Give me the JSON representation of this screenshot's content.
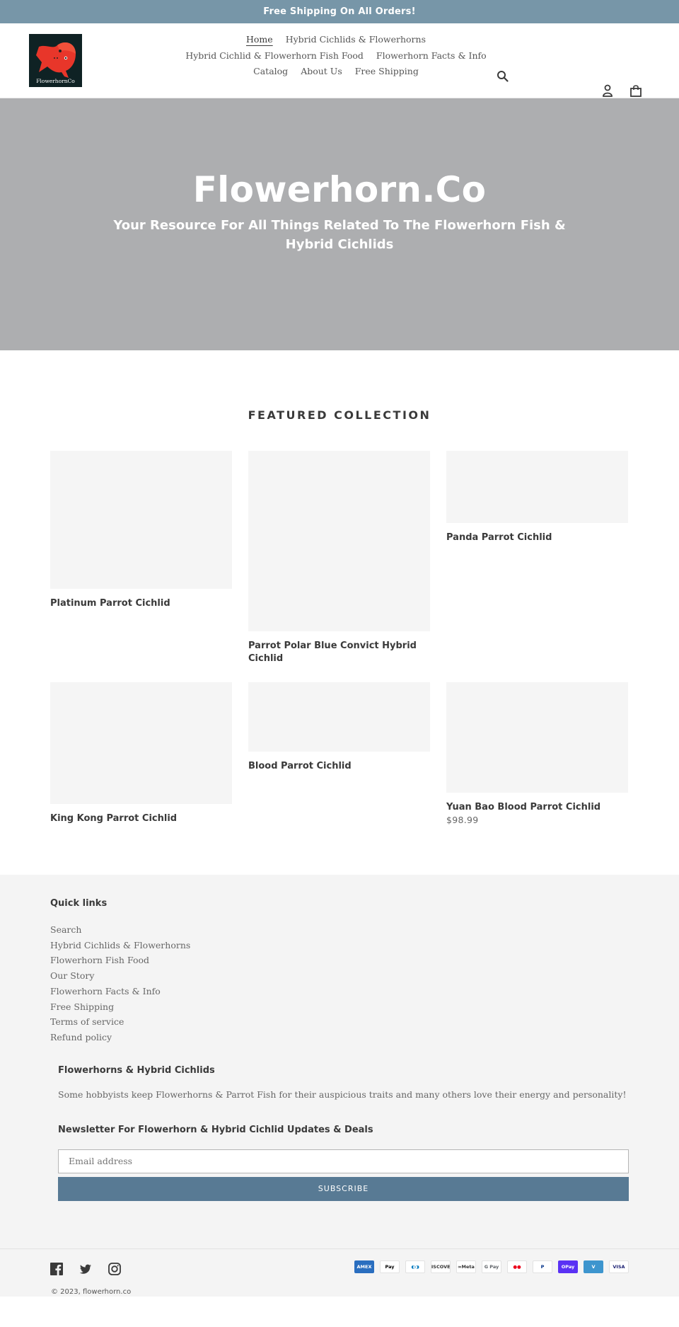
{
  "announcement": "Free Shipping On All Orders!",
  "header": {
    "logo_text": "FlowerhornCo",
    "nav": [
      [
        {
          "label": "Home",
          "active": true
        },
        {
          "label": "Hybrid Cichlids & Flowerhorns"
        }
      ],
      [
        {
          "label": "Hybrid Cichlid & Flowerhorn Fish Food"
        },
        {
          "label": "Flowerhorn Facts & Info"
        }
      ],
      [
        {
          "label": "Catalog"
        },
        {
          "label": "About Us"
        },
        {
          "label": "Free Shipping"
        }
      ]
    ],
    "icons": {
      "search": "search-icon",
      "account": "account-icon",
      "cart": "cart-icon"
    }
  },
  "hero": {
    "title": "Flowerhorn.Co",
    "subtitle": "Your Resource For All Things Related To The Flowerhorn Fish & Hybrid Cichlids"
  },
  "featured": {
    "heading": "FEATURED COLLECTION",
    "products": [
      {
        "title": "Platinum Parrot Cichlid",
        "price": ""
      },
      {
        "title": "Parrot Polar Blue Convict Hybrid Cichlid",
        "price": ""
      },
      {
        "title": "Panda Parrot Cichlid",
        "price": ""
      },
      {
        "title": "King Kong Parrot Cichlid",
        "price": ""
      },
      {
        "title": "Blood Parrot Cichlid",
        "price": ""
      },
      {
        "title": "Yuan Bao Blood Parrot Cichlid",
        "price": "$98.99"
      }
    ]
  },
  "footer": {
    "quick_links_heading": "Quick links",
    "quick_links": [
      "Search",
      "Hybrid Cichlids & Flowerhorns",
      "Flowerhorn Fish Food",
      "Our Story",
      "Flowerhorn Facts & Info",
      "Free Shipping",
      "Terms of service",
      "Refund policy"
    ],
    "about_heading": "Flowerhorns & Hybrid Cichlids",
    "about_text": "Some hobbyists keep Flowerhorns & Parrot Fish for their auspicious traits and many others love their energy and personality!",
    "newsletter_heading": "Newsletter For Flowerhorn & Hybrid Cichlid Updates & Deals",
    "email_placeholder": "Email address",
    "subscribe_label": "SUBSCRIBE",
    "social": [
      "facebook-icon",
      "twitter-icon",
      "instagram-icon"
    ],
    "copyright": "© 2023, flowerhorn.co",
    "payments": [
      {
        "name": "American Express",
        "label": "AMEX",
        "bg": "#2a6ebf",
        "fg": "#ffffff"
      },
      {
        "name": "Apple Pay",
        "label": "Pay",
        "bg": "#ffffff",
        "fg": "#000000"
      },
      {
        "name": "Diners Club",
        "label": "◐◑",
        "bg": "#ffffff",
        "fg": "#0079be"
      },
      {
        "name": "Discover",
        "label": "DISCOVER",
        "bg": "#ffffff",
        "fg": "#333333"
      },
      {
        "name": "Meta Pay",
        "label": "∞Meta",
        "bg": "#ffffff",
        "fg": "#333333"
      },
      {
        "name": "Google Pay",
        "label": "G Pay",
        "bg": "#ffffff",
        "fg": "#5f6368"
      },
      {
        "name": "Mastercard",
        "label": "●●",
        "bg": "#ffffff",
        "fg": "#eb001b"
      },
      {
        "name": "PayPal",
        "label": "P",
        "bg": "#ffffff",
        "fg": "#003087"
      },
      {
        "name": "Shop Pay",
        "label": "OPay",
        "bg": "#5a31f4",
        "fg": "#ffffff"
      },
      {
        "name": "Venmo",
        "label": "V",
        "bg": "#3d95ce",
        "fg": "#ffffff"
      },
      {
        "name": "Visa",
        "label": "VISA",
        "bg": "#ffffff",
        "fg": "#1a1f71"
      }
    ]
  },
  "colors": {
    "announcement_bg": "#7796a8",
    "hero_bg": "#adaeb0",
    "button_bg": "#587a94",
    "footer_bg": "#f4f4f4",
    "placeholder_bg": "#f5f5f5"
  }
}
